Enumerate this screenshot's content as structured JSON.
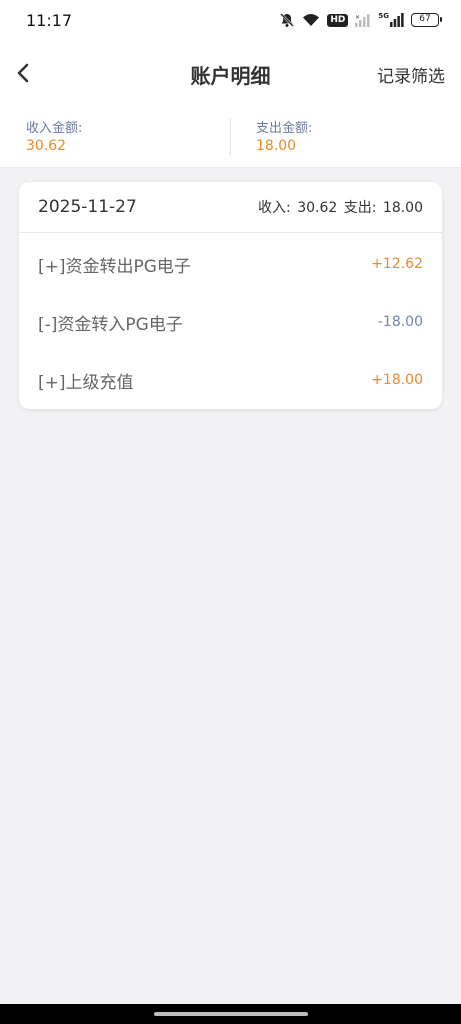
{
  "status_bar": {
    "time": "11:17",
    "hd_label": "HD",
    "network_label": "5G",
    "battery_level": "67"
  },
  "nav": {
    "title": "账户明细",
    "filter_label": "记录筛选"
  },
  "summary": {
    "income_label": "收入金额:",
    "income_value": "30.62",
    "expense_label": "支出金额:",
    "expense_value": "18.00"
  },
  "day_card": {
    "date": "2025-11-27",
    "income_label": "收入:",
    "income_value": "30.62",
    "expense_label": "支出:",
    "expense_value": "18.00",
    "transactions": [
      {
        "label": "[+]资金转出PG电子",
        "amount": "+12.62"
      },
      {
        "label": "[-]资金转入PG电子",
        "amount": "-18.00"
      },
      {
        "label": "[+]上级充值",
        "amount": "+18.00"
      }
    ]
  },
  "colors": {
    "income_orange": "#e98a2c",
    "expense_blue": "#7585ad",
    "label_blue": "#6d7aa6",
    "background": "#f2f2f5"
  }
}
